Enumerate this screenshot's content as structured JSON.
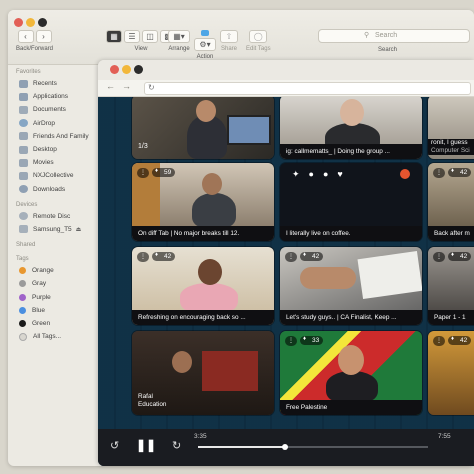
{
  "finder": {
    "toolbar": {
      "back_forward": "Back/Forward",
      "view": "View",
      "arrange": "Arrange",
      "action": "Action",
      "share": "Share",
      "edit_tags": "Edit Tags",
      "search_placeholder": "Search",
      "search_label": "Search"
    },
    "sidebar": {
      "favorites_header": "Favorites",
      "favorites": [
        {
          "label": "Recents",
          "icon": "clock-icon"
        },
        {
          "label": "Applications",
          "icon": "applications-icon"
        },
        {
          "label": "Documents",
          "icon": "document-icon"
        },
        {
          "label": "AirDrop",
          "icon": "airdrop-icon"
        },
        {
          "label": "Friends And Family",
          "icon": "folder-icon"
        },
        {
          "label": "Desktop",
          "icon": "desktop-icon"
        },
        {
          "label": "Movies",
          "icon": "movies-icon"
        },
        {
          "label": "NXJCollective",
          "icon": "folder-icon"
        },
        {
          "label": "Downloads",
          "icon": "downloads-icon"
        }
      ],
      "devices_header": "Devices",
      "devices": [
        {
          "label": "Remote Disc",
          "icon": "disc-icon"
        },
        {
          "label": "Samsung_T5",
          "icon": "drive-icon"
        }
      ],
      "shared_header": "Shared",
      "tags_header": "Tags",
      "tags": [
        {
          "label": "Orange",
          "color": "#e8972f"
        },
        {
          "label": "Gray",
          "color": "#9a9a9a"
        },
        {
          "label": "Purple",
          "color": "#9f63c9"
        },
        {
          "label": "Blue",
          "color": "#4b8fe0"
        },
        {
          "label": "Green",
          "color": "#1a1a1a"
        },
        {
          "label": "All Tags...",
          "color": "#d8d6cf"
        }
      ]
    }
  },
  "stream": {
    "tiles": {
      "t1": {
        "caption": "",
        "counter": "1/3"
      },
      "t3": {
        "caption": "ig: callmematts_ | Doing the group ...",
        "counter": ""
      },
      "t4": {
        "caption": "ronit, I guess",
        "subcaption": "Computer Sci"
      },
      "t5": {
        "caption": "On diff Tab | No major breaks till 12.",
        "counter": "59"
      },
      "t6": {
        "caption": "I literally live on coffee.",
        "counter": ""
      },
      "t7": {
        "caption": "Back after m",
        "counter": "42"
      },
      "t8": {
        "caption": "Refreshing on encouraging back so ...",
        "counter": "42"
      },
      "t9": {
        "caption": "Let's study guys.. | CA Finalist, Keep ...",
        "counter": "42"
      },
      "t10": {
        "caption": "Paper 1 - 1",
        "counter": "42"
      },
      "t11": {
        "caption": "Rafal",
        "subcaption": "Education",
        "counter": ""
      },
      "t12": {
        "caption": "Free Palestine",
        "counter": "33"
      },
      "t13": {
        "caption": "",
        "counter": "42"
      }
    },
    "player": {
      "time_current": "3:35",
      "time_total": "7:55",
      "progress": 0.38
    }
  }
}
